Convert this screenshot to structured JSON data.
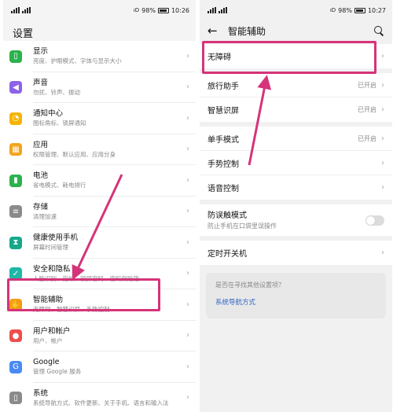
{
  "left": {
    "status": {
      "vibrate": "ıD",
      "battery": "98%",
      "time": "10:26"
    },
    "title": "设置",
    "items": [
      {
        "title": "显示",
        "subtitle": "亮度、护眼模式、字体与显示大小",
        "icon": "display-icon",
        "color": "#2bb24c",
        "glyph": "▯"
      },
      {
        "title": "声音",
        "subtitle": "勿扰、铃声、振动",
        "icon": "sound-icon",
        "color": "#8b62e8",
        "glyph": "◀"
      },
      {
        "title": "通知中心",
        "subtitle": "图标角标、锁屏通知",
        "icon": "notification-icon",
        "color": "#f6b400",
        "glyph": "◔"
      },
      {
        "title": "应用",
        "subtitle": "权限管理、默认应用、应用分身",
        "icon": "apps-icon",
        "color": "#f3a41b",
        "glyph": "▦"
      },
      {
        "title": "电池",
        "subtitle": "省电模式、耗电排行",
        "icon": "battery-icon",
        "color": "#2bb24c",
        "glyph": "▮"
      },
      {
        "title": "存储",
        "subtitle": "清理加速",
        "icon": "storage-icon",
        "color": "#8a8a8a",
        "glyph": "≡"
      },
      {
        "title": "健康使用手机",
        "subtitle": "屏幕时间管理",
        "icon": "hourglass-icon",
        "color": "#15a88b",
        "glyph": "⧗"
      },
      {
        "title": "安全和隐私",
        "subtitle": "人脸识别、指纹、锁屏密码、密码保险箱",
        "icon": "shield-icon",
        "color": "#1fb7a8",
        "glyph": "✓"
      },
      {
        "title": "智能辅助",
        "subtitle": "无障碍、智慧识屏、手势控制",
        "icon": "hand-icon",
        "color": "#f39c12",
        "glyph": "✋"
      },
      {
        "title": "用户和帐户",
        "subtitle": "用户、帐户",
        "icon": "user-icon",
        "color": "#ef4d4d",
        "glyph": "●"
      },
      {
        "title": "Google",
        "subtitle": "管理 Google 服务",
        "icon": "google-icon",
        "color": "#4a8af4",
        "glyph": "G"
      },
      {
        "title": "系统",
        "subtitle": "系统导航方式、软件更新、关于手机、语言和输入法",
        "icon": "system-icon",
        "color": "#8a8a8a",
        "glyph": "▯"
      }
    ]
  },
  "right": {
    "status": {
      "vibrate": "ıD",
      "battery": "98%",
      "time": "10:27"
    },
    "title": "智能辅助",
    "group1": [
      {
        "label": "无障碍",
        "value": ""
      }
    ],
    "group2": [
      {
        "label": "旅行助手",
        "value": "已开启"
      },
      {
        "label": "智慧识屏",
        "value": "已开启"
      }
    ],
    "group3": [
      {
        "label": "单手模式",
        "value": "已开启"
      },
      {
        "label": "手势控制",
        "value": ""
      },
      {
        "label": "语音控制",
        "value": ""
      }
    ],
    "toggle_row": {
      "label": "防误触模式",
      "subtitle": "防止手机在口袋里误操作",
      "state": "off"
    },
    "group5": [
      {
        "label": "定时开关机",
        "value": ""
      }
    ],
    "suggest": {
      "question": "是否在寻找其他设置项？",
      "link": "系统导航方式"
    }
  },
  "annotation_color": "#d6337a"
}
